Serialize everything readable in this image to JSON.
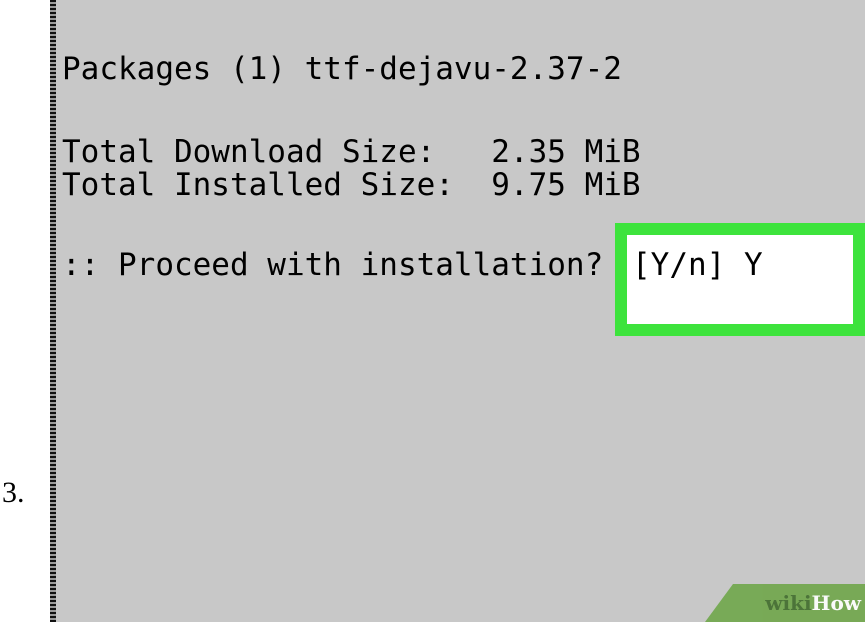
{
  "step": {
    "number": "3."
  },
  "terminal": {
    "packages_line": "Packages (1) ttf-dejavu-2.37-2",
    "download_line": "Total Download Size:   2.35 MiB",
    "installed_line": "Total Installed Size:  9.75 MiB",
    "proceed_prompt": ":: Proceed with installation? ",
    "proceed_answer": "[Y/n] Y"
  },
  "colors": {
    "terminal_background": "#c8c8c8",
    "highlight_border": "#3de33c",
    "watermark_green": "#6fa64a"
  },
  "watermark": {
    "text": "wikiHow"
  }
}
